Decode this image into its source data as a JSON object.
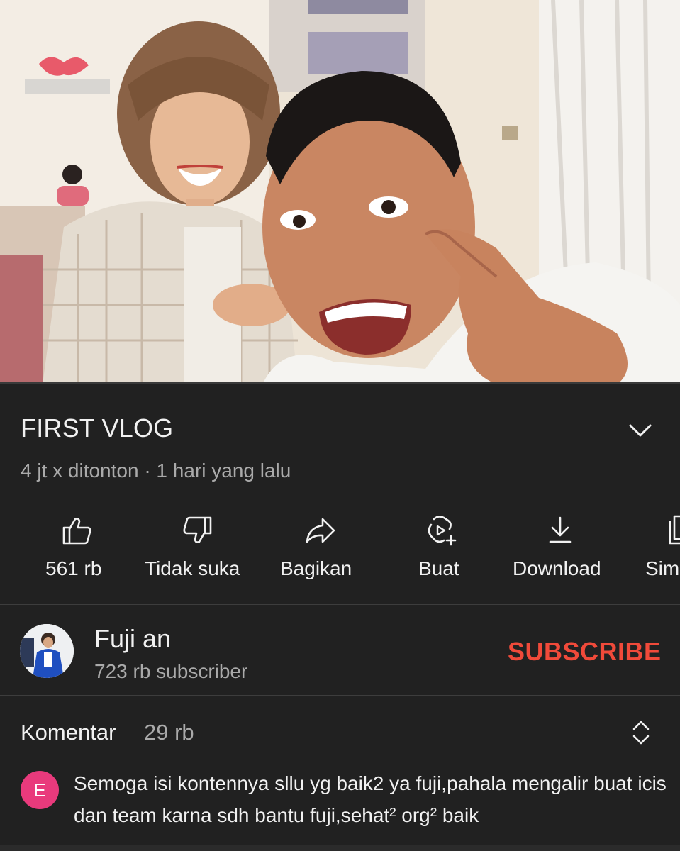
{
  "video": {
    "thumbnail": "vlog-scene",
    "progress": 0.0
  },
  "title": "FIRST VLOG",
  "meta": "4 jt x ditonton · 1 hari yang lalu",
  "actions": [
    {
      "icon": "thumb-up-icon",
      "label": "561 rb"
    },
    {
      "icon": "thumb-down-icon",
      "label": "Tidak suka"
    },
    {
      "icon": "share-icon",
      "label": "Bagikan"
    },
    {
      "icon": "create-icon",
      "label": "Buat"
    },
    {
      "icon": "download-icon",
      "label": "Download"
    },
    {
      "icon": "save-icon",
      "label": "Sim"
    }
  ],
  "channel": {
    "name": "Fuji an",
    "subscribers": "723 rb subscriber",
    "subscribe_label": "SUBSCRIBE"
  },
  "comments": {
    "label": "Komentar",
    "count": "29 rb",
    "top": {
      "avatar_letter": "E",
      "text": "Semoga isi kontennya sllu yg baik2 ya fuji,pahala mengalir buat icis dan team karna sdh bantu fuji,sehat² org² baik"
    }
  },
  "colors": {
    "background": "#212121",
    "subscribe": "#f04a3a",
    "comment_avatar": "#e93a7c",
    "secondary_text": "#aaaaaa"
  }
}
